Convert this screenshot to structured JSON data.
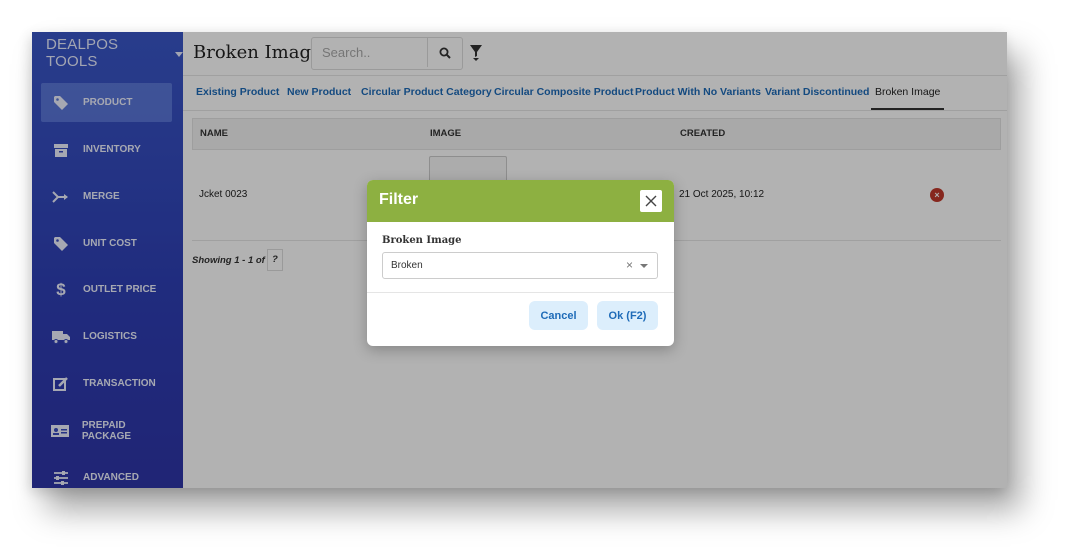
{
  "sidebar": {
    "brand": "DEALPOS TOOLS",
    "items": [
      {
        "label": "PRODUCT",
        "icon": "tag-icon"
      },
      {
        "label": "INVENTORY",
        "icon": "archive-icon"
      },
      {
        "label": "MERGE",
        "icon": "merge-arrow-icon"
      },
      {
        "label": "UNIT COST",
        "icon": "tag-icon"
      },
      {
        "label": "OUTLET PRICE",
        "icon": "dollar-icon"
      },
      {
        "label": "LOGISTICS",
        "icon": "truck-icon"
      },
      {
        "label": "TRANSACTION",
        "icon": "edit-icon"
      },
      {
        "label": "PREPAID PACKAGE",
        "icon": "id-card-icon"
      },
      {
        "label": "ADVANCED",
        "icon": "sliders-icon"
      }
    ],
    "active_index": 0
  },
  "header": {
    "title": "Broken Image",
    "search_placeholder": "Search..",
    "search_value": ""
  },
  "tabs": [
    "Existing Product",
    "New Product",
    "Circular Product Category",
    "Circular Composite Product",
    "Product With No Variants",
    "Variant Discontinued",
    "Broken Image"
  ],
  "active_tab": "Broken Image",
  "table": {
    "columns": [
      "NAME",
      "IMAGE",
      "CREATED"
    ],
    "rows": [
      {
        "name": "Jcket 0023",
        "created": "21 Oct 2025, 10:12"
      }
    ],
    "delete_symbol": "×"
  },
  "pagination": {
    "showing": "Showing 1 - 1 of",
    "total": "?"
  },
  "modal": {
    "title": "Filter",
    "field_label": "Broken Image",
    "select_value": "Broken",
    "clear_symbol": "×",
    "cancel_label": "Cancel",
    "ok_label": "Ok (F2)"
  },
  "colors": {
    "sidebar": "#2e3eb4",
    "modal_header": "#8db041",
    "link": "#1e6bb8",
    "delete": "#c0392b"
  }
}
